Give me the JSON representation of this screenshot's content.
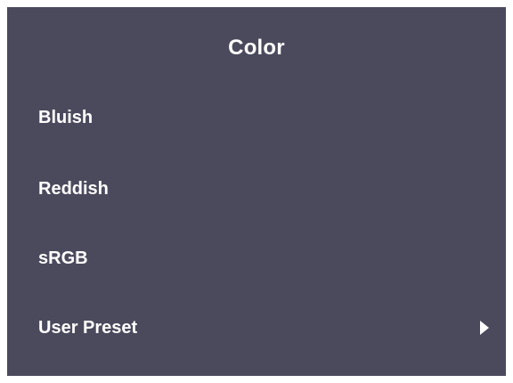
{
  "menu": {
    "title": "Color",
    "items": [
      {
        "label": "Bluish",
        "has_submenu": false
      },
      {
        "label": "Reddish",
        "has_submenu": false
      },
      {
        "label": "sRGB",
        "has_submenu": false
      },
      {
        "label": "User Preset",
        "has_submenu": true,
        "submenu_icon": "chevron-right-icon"
      }
    ]
  },
  "colors": {
    "background": "#4b4a5d",
    "text": "#ffffff",
    "frame": "#ffffff"
  }
}
